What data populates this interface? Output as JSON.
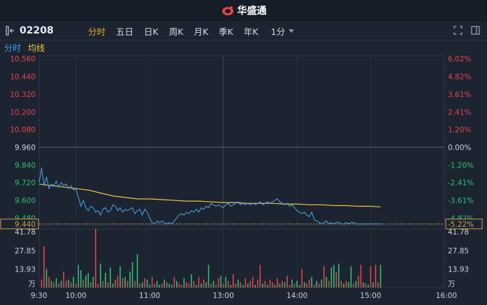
{
  "app": {
    "brand": "华盛通"
  },
  "stock": {
    "code": "02208"
  },
  "tabs": [
    "分时",
    "五日",
    "日K",
    "周K",
    "月K",
    "季K",
    "年K"
  ],
  "active_tab": "分时",
  "interval": "1分",
  "legend": {
    "minute": "分时",
    "average": "均线"
  },
  "icons": {
    "sidebar_toggle": "panel-toggle-icon",
    "fullscreen": "expand-icon",
    "layout": "split-panel-icon"
  },
  "colors": {
    "up": "#e8434b",
    "down": "#2fbf71",
    "line": "#4aa8ee",
    "avg": "#f0c240",
    "bg": "#1b2430"
  },
  "chart_data": [
    {
      "type": "line",
      "reference_price": 9.96,
      "last_price": 9.44,
      "last_change": "-5.22%",
      "price_ticks": [
        "10.560",
        "10.440",
        "10.320",
        "10.200",
        "10.080",
        "9.960",
        "9.840",
        "9.720",
        "9.600",
        "9.480"
      ],
      "price_tick_values": [
        10.56,
        10.44,
        10.32,
        10.2,
        10.08,
        9.96,
        9.84,
        9.72,
        9.6,
        9.48
      ],
      "pct_ticks": [
        "6.02%",
        "4.82%",
        "3.61%",
        "2.41%",
        "1.20%",
        "0.00%",
        "-1.20%",
        "-2.41%",
        "-3.61%",
        "-4.82%"
      ],
      "ylim": [
        9.43,
        10.58
      ],
      "x_ticks": [
        "9:30",
        "10:00",
        "11:00",
        "13:00",
        "14:00",
        "15:00",
        "16:00"
      ],
      "x_tick_minutes": [
        0,
        30,
        90,
        150,
        210,
        270,
        330
      ],
      "x_range": [
        0,
        330
      ],
      "series": [
        {
          "x": [
            0,
            2,
            4,
            6,
            8,
            10,
            12,
            14,
            16,
            18,
            20,
            22,
            24,
            26,
            28,
            30,
            32,
            34,
            36,
            38,
            40,
            42,
            44,
            46,
            48,
            50,
            52,
            54,
            56,
            58,
            60,
            62,
            64,
            66,
            68,
            70,
            72,
            74,
            76,
            78,
            80,
            82,
            84,
            86,
            88,
            90,
            92,
            94,
            96,
            98,
            100,
            102,
            104,
            106,
            108,
            110,
            112,
            114,
            116,
            118,
            120,
            122,
            124,
            126,
            128,
            130,
            132,
            134,
            136,
            138,
            140,
            142,
            144,
            146,
            148,
            150,
            152,
            154,
            156,
            158,
            160,
            162,
            164,
            166,
            168,
            170,
            172,
            174,
            176,
            178,
            180,
            182,
            184,
            186,
            188,
            190,
            192,
            194,
            196,
            198,
            200,
            202,
            204,
            206,
            208,
            210,
            212,
            214,
            216,
            218,
            220,
            222,
            224,
            226,
            228,
            230,
            232,
            234,
            236,
            238,
            240,
            242,
            244,
            246,
            248,
            250,
            252,
            254,
            256,
            258,
            260,
            262,
            264,
            266,
            268,
            270,
            272,
            274,
            276,
            278
          ],
          "values": [
            9.72,
            9.82,
            9.7,
            9.76,
            9.68,
            9.71,
            9.7,
            9.73,
            9.69,
            9.72,
            9.7,
            9.71,
            9.68,
            9.7,
            9.67,
            9.68,
            9.62,
            9.56,
            9.6,
            9.55,
            9.53,
            9.56,
            9.55,
            9.52,
            9.53,
            9.5,
            9.54,
            9.55,
            9.52,
            9.53,
            9.57,
            9.56,
            9.53,
            9.55,
            9.52,
            9.54,
            9.53,
            9.54,
            9.55,
            9.51,
            9.53,
            9.54,
            9.5,
            9.54,
            9.52,
            9.48,
            9.45,
            9.44,
            9.46,
            9.45,
            9.46,
            9.45,
            9.44,
            9.45,
            9.44,
            9.46,
            9.48,
            9.5,
            9.51,
            9.5,
            9.52,
            9.51,
            9.53,
            9.52,
            9.54,
            9.52,
            9.55,
            9.54,
            9.56,
            9.55,
            9.58,
            9.57,
            9.56,
            9.57,
            9.56,
            9.55,
            9.57,
            9.58,
            9.56,
            9.57,
            9.58,
            9.59,
            9.57,
            9.58,
            9.57,
            9.58,
            9.57,
            9.58,
            9.57,
            9.58,
            9.59,
            9.57,
            9.58,
            9.59,
            9.58,
            9.59,
            9.6,
            9.61,
            9.59,
            9.58,
            9.57,
            9.58,
            9.56,
            9.57,
            9.55,
            9.53,
            9.52,
            9.51,
            9.52,
            9.5,
            9.49,
            9.52,
            9.47,
            9.46,
            9.45,
            9.44,
            9.45,
            9.46,
            9.44,
            9.45,
            9.44,
            9.45,
            9.45,
            9.44,
            9.44,
            9.45,
            9.44,
            9.45,
            9.45,
            9.44,
            9.44,
            9.44,
            9.44,
            9.44,
            9.44,
            9.44,
            9.44,
            9.44,
            9.44,
            9.44
          ]
        },
        {
          "x": [
            0,
            10,
            20,
            30,
            40,
            50,
            60,
            70,
            80,
            90,
            100,
            110,
            120,
            130,
            140,
            150,
            160,
            170,
            180,
            190,
            200,
            210,
            220,
            230,
            240,
            250,
            260,
            270,
            278
          ],
          "values": [
            9.71,
            9.7,
            9.69,
            9.68,
            9.67,
            9.65,
            9.63,
            9.62,
            9.61,
            9.61,
            9.605,
            9.6,
            9.595,
            9.595,
            9.59,
            9.585,
            9.585,
            9.58,
            9.58,
            9.58,
            9.575,
            9.575,
            9.57,
            9.57,
            9.565,
            9.565,
            9.56,
            9.56,
            9.555
          ]
        }
      ]
    },
    {
      "type": "bar",
      "unit": "万",
      "vol_ticks": [
        "41.78",
        "27.85",
        "13.93"
      ],
      "vol_tick_values": [
        41.78,
        27.85,
        13.93
      ],
      "ylim": [
        0,
        44
      ],
      "x": [
        2,
        4,
        6,
        8,
        10,
        12,
        14,
        16,
        18,
        20,
        22,
        24,
        26,
        28,
        30,
        32,
        34,
        36,
        38,
        40,
        42,
        44,
        46,
        48,
        50,
        52,
        54,
        56,
        58,
        60,
        62,
        64,
        66,
        68,
        70,
        72,
        74,
        76,
        78,
        80,
        82,
        84,
        86,
        88,
        90,
        92,
        94,
        96,
        98,
        100,
        102,
        104,
        106,
        108,
        110,
        112,
        114,
        116,
        118,
        120,
        122,
        124,
        126,
        128,
        130,
        132,
        134,
        136,
        138,
        140,
        142,
        144,
        146,
        148,
        150,
        152,
        154,
        156,
        158,
        160,
        162,
        164,
        166,
        168,
        170,
        172,
        174,
        176,
        178,
        180,
        182,
        184,
        186,
        188,
        190,
        192,
        194,
        196,
        198,
        200,
        202,
        204,
        206,
        208,
        210,
        212,
        214,
        216,
        218,
        220,
        222,
        224,
        226,
        228,
        230,
        232,
        234,
        236,
        238,
        240,
        242,
        244,
        246,
        248,
        250,
        252,
        254,
        256,
        258,
        260,
        262,
        264,
        266,
        268,
        270,
        272,
        274,
        276,
        278
      ],
      "values": [
        6,
        31,
        14,
        8,
        5,
        4,
        7,
        3,
        5,
        12,
        5,
        6,
        4,
        8,
        3,
        17,
        13,
        6,
        9,
        11,
        4,
        8,
        44,
        3,
        18,
        5,
        11,
        4,
        15,
        3,
        6,
        9,
        16,
        7,
        8,
        5,
        12,
        19,
        5,
        25,
        3,
        4,
        7,
        6,
        2,
        8,
        3,
        5,
        2,
        3,
        6,
        4,
        3,
        2,
        8,
        5,
        3,
        2,
        7,
        4,
        3,
        10,
        5,
        2,
        8,
        3,
        6,
        4,
        17,
        3,
        5,
        2,
        7,
        9,
        3,
        8,
        5,
        2,
        10,
        3,
        6,
        4,
        2,
        7,
        3,
        5,
        8,
        2,
        6,
        17,
        3,
        5,
        2,
        6,
        4,
        2,
        7,
        3,
        5,
        4,
        9,
        2,
        6,
        3,
        5,
        2,
        14,
        4,
        3,
        6,
        8,
        2,
        5,
        3,
        6,
        16,
        8,
        5,
        15,
        17,
        12,
        18,
        5,
        3,
        5,
        4,
        16,
        3,
        5,
        9,
        17,
        4,
        3,
        2,
        16,
        4,
        17,
        4,
        17
      ],
      "up": [
        1,
        1,
        0,
        1,
        0,
        1,
        0,
        1,
        0,
        1,
        1,
        0,
        1,
        0,
        1,
        0,
        0,
        1,
        0,
        0,
        1,
        0,
        1,
        1,
        0,
        1,
        0,
        1,
        0,
        0,
        1,
        1,
        0,
        1,
        0,
        1,
        0,
        0,
        1,
        0,
        1,
        0,
        1,
        0,
        0,
        1,
        1,
        0,
        0,
        1,
        0,
        1,
        0,
        0,
        1,
        0,
        1,
        1,
        0,
        1,
        1,
        0,
        1,
        0,
        1,
        0,
        1,
        0,
        0,
        1,
        0,
        1,
        1,
        0,
        1,
        0,
        1,
        0,
        1,
        1,
        0,
        1,
        0,
        1,
        0,
        1,
        1,
        0,
        1,
        1,
        0,
        1,
        0,
        1,
        1,
        0,
        1,
        0,
        1,
        0,
        1,
        1,
        0,
        1,
        0,
        0,
        1,
        0,
        1,
        1,
        0,
        1,
        0,
        1,
        0,
        1,
        0,
        1,
        0,
        0,
        1,
        0,
        1,
        0,
        1,
        0,
        0,
        1,
        0,
        1,
        1,
        0,
        1,
        0,
        1,
        0,
        1,
        1,
        0
      ]
    }
  ]
}
